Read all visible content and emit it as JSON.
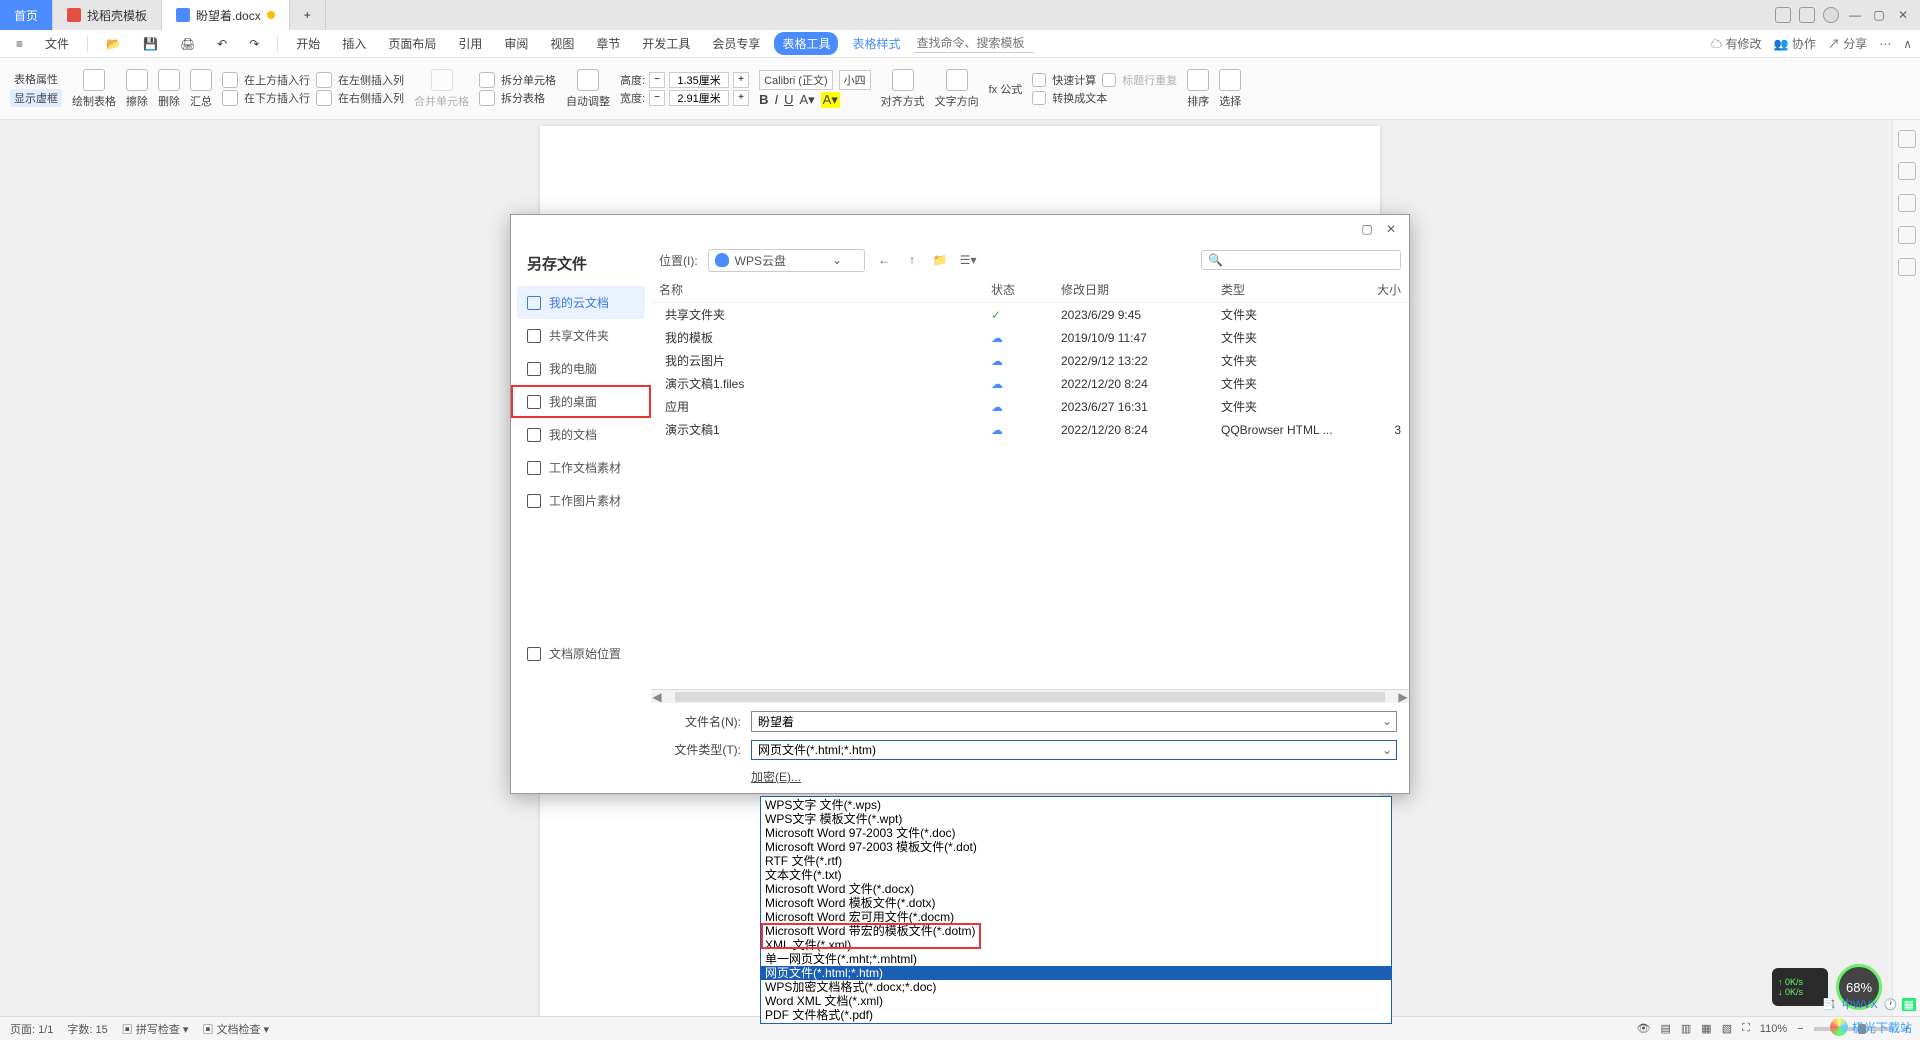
{
  "tabs": {
    "home": "首页",
    "t1": "找稻壳模板",
    "t2": "盼望着.docx"
  },
  "menu": {
    "file": "文件",
    "items": [
      "开始",
      "插入",
      "页面布局",
      "引用",
      "审阅",
      "视图",
      "章节",
      "开发工具",
      "会员专享"
    ],
    "active": "表格工具",
    "style": "表格样式",
    "search_ph": "查找命令、搜索模板",
    "track": "有修改",
    "coop": "协作",
    "share": "分享"
  },
  "ribbon": {
    "g1a": "表格属性",
    "g1b": "显示虚框",
    "g2": "绘制表格",
    "g3": "擦除",
    "g4": "删除",
    "g5": "汇总",
    "g6a": "在上方插入行",
    "g6b": "在下方插入行",
    "g6c": "在左侧插入列",
    "g6d": "在右侧插入列",
    "g7": "合并单元格",
    "g8a": "拆分单元格",
    "g8b": "拆分表格",
    "g9": "自动调整",
    "h_label": "高度:",
    "h_val": "1.35厘米",
    "w_label": "宽度:",
    "w_val": "2.91厘米",
    "font": "Calibri (正文)",
    "size": "小四",
    "align": "对齐方式",
    "textdir": "文字方向",
    "formula": "fx 公式",
    "quick": "快速计算",
    "header": "标题行重复",
    "totext": "转换成文本",
    "sort": "排序",
    "select": "选择"
  },
  "dialog": {
    "title": "另存文件",
    "loc_label": "位置(I):",
    "loc_value": "WPS云盘",
    "search_ph": "",
    "sidebar": [
      {
        "label": "我的云文档",
        "active": true
      },
      {
        "label": "共享文件夹"
      },
      {
        "label": "我的电脑"
      },
      {
        "label": "我的桌面",
        "highlight": true
      },
      {
        "label": "我的文档"
      },
      {
        "label": "工作文档素材"
      },
      {
        "label": "工作图片素材"
      },
      {
        "label": "文档原始位置"
      }
    ],
    "cols": {
      "name": "名称",
      "status": "状态",
      "date": "修改日期",
      "type": "类型",
      "size": "大小"
    },
    "files": [
      {
        "icon": "share",
        "name": "共享文件夹",
        "status": "ok",
        "date": "2023/6/29 9:45",
        "type": "文件夹",
        "size": ""
      },
      {
        "icon": "folder",
        "name": "我的模板",
        "status": "cloud",
        "date": "2019/10/9 11:47",
        "type": "文件夹",
        "size": ""
      },
      {
        "icon": "folder",
        "name": "我的云图片",
        "status": "cloud",
        "date": "2022/9/12 13:22",
        "type": "文件夹",
        "size": ""
      },
      {
        "icon": "folder",
        "name": "演示文稿1.files",
        "status": "cloud",
        "date": "2022/12/20 8:24",
        "type": "文件夹",
        "size": ""
      },
      {
        "icon": "folder",
        "name": "应用",
        "status": "cloud",
        "date": "2023/6/27 16:31",
        "type": "文件夹",
        "size": ""
      },
      {
        "icon": "file",
        "name": "演示文稿1",
        "status": "cloud",
        "date": "2022/12/20 8:24",
        "type": "QQBrowser HTML ...",
        "size": "3"
      }
    ],
    "fn_label": "文件名(N):",
    "fn_value": "盼望着",
    "ft_label": "文件类型(T):",
    "ft_value": "网页文件(*.html;*.htm)",
    "enc_label": "加密(E)..."
  },
  "dropdown_options": [
    "WPS文字 文件(*.wps)",
    "WPS文字 模板文件(*.wpt)",
    "Microsoft Word 97-2003 文件(*.doc)",
    "Microsoft Word 97-2003 模板文件(*.dot)",
    "RTF 文件(*.rtf)",
    "文本文件(*.txt)",
    "Microsoft Word 文件(*.docx)",
    "Microsoft Word 模板文件(*.dotx)",
    "Microsoft Word 宏可用文件(*.docm)",
    "Microsoft Word 带宏的模板文件(*.dotm)",
    "XML 文件(*.xml)",
    "单一网页文件(*.mht;*.mhtml)",
    "网页文件(*.html;*.htm)",
    "WPS加密文档格式(*.docx;*.doc)",
    "Word XML 文档(*.xml)",
    "PDF 文件格式(*.pdf)"
  ],
  "dropdown_selected_index": 12,
  "status": {
    "page": "页面: 1/1",
    "words": "字数: 15",
    "spell": "拼写检查",
    "doccheck": "文档检查",
    "zoom": "110%"
  },
  "net": {
    "up": "0K/s",
    "down": "0K/s"
  },
  "pct": "68%",
  "brand": "极光下载站",
  "tray": "中WVX"
}
